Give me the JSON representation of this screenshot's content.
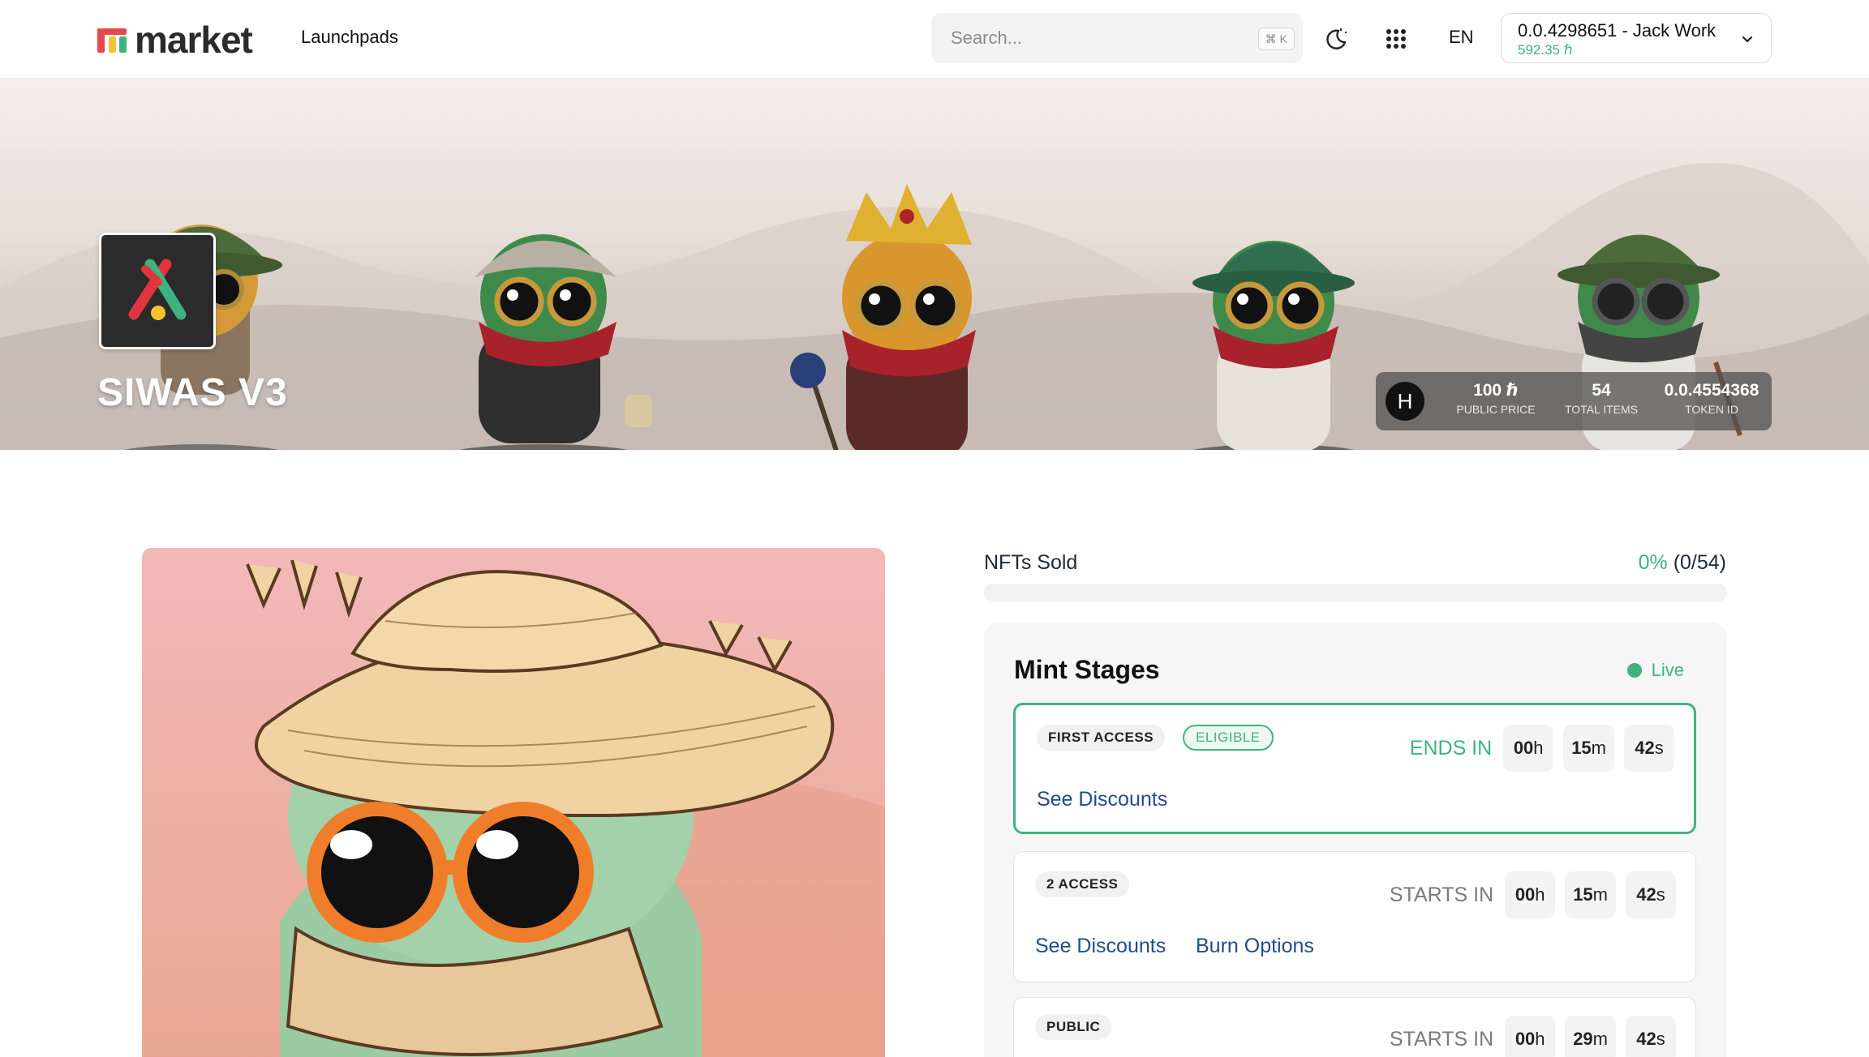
{
  "header": {
    "logo_text": "market",
    "nav_launchpads": "Launchpads",
    "search_placeholder": "Search...",
    "search_shortcut": "⌘ K",
    "language": "EN",
    "account": {
      "name": "0.0.4298651 - Jack Work",
      "balance": "592.35 ℏ"
    }
  },
  "banner": {
    "collection_name": "SIWAS V3",
    "currency_symbol": "H",
    "stats": [
      {
        "value": "100 ℏ",
        "label": "PUBLIC PRICE"
      },
      {
        "value": "54",
        "label": "TOTAL ITEMS"
      },
      {
        "value": "0.0.4554368",
        "label": "TOKEN ID"
      }
    ]
  },
  "sales": {
    "label": "NFTs Sold",
    "percent": "0%",
    "count": "(0/54)",
    "progress_fraction": 0
  },
  "mint_stages": {
    "title": "Mint Stages",
    "status": "Live",
    "stages": [
      {
        "name": "FIRST ACCESS",
        "badge": "ELIGIBLE",
        "timer_label": "ENDS IN",
        "hours": "00",
        "minutes": "15",
        "seconds": "42",
        "links": [
          "See Discounts"
        ]
      },
      {
        "name": "2 ACCESS",
        "timer_label": "STARTS IN",
        "hours": "00",
        "minutes": "15",
        "seconds": "42",
        "links": [
          "See Discounts",
          "Burn Options"
        ]
      },
      {
        "name": "PUBLIC",
        "timer_label": "STARTS IN",
        "hours": "00",
        "minutes": "29",
        "seconds": "42",
        "links": []
      }
    ],
    "units": {
      "h": "h",
      "m": "m",
      "s": "s"
    }
  },
  "colors": {
    "accent_green": "#3fb37f",
    "link_blue": "#1e4d8c",
    "logo_red": "#e5484d",
    "logo_yellow": "#f4c430"
  }
}
